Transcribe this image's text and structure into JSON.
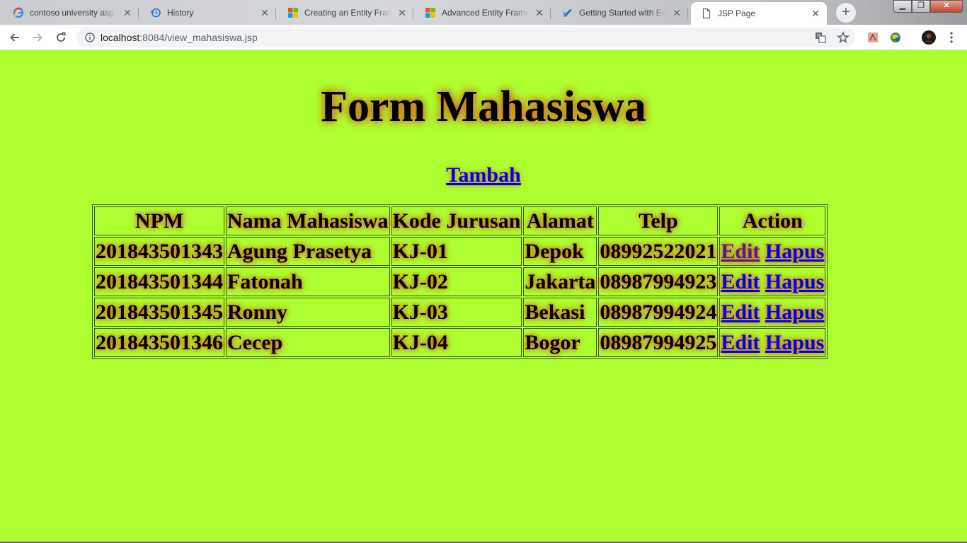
{
  "browser": {
    "tabs": [
      {
        "title": "contoso university asp.n",
        "icon": "google-icon",
        "active": false
      },
      {
        "title": "History",
        "icon": "history-icon",
        "active": false
      },
      {
        "title": "Creating an Entity Frame",
        "icon": "microsoft-icon",
        "active": false
      },
      {
        "title": "Advanced Entity Framew",
        "icon": "microsoft-icon",
        "active": false
      },
      {
        "title": "Getting Started with Enti",
        "icon": "visual-studio-icon",
        "active": false
      },
      {
        "title": "JSP Page",
        "icon": "page-icon",
        "active": true
      }
    ],
    "url_host": "localhost",
    "url_path": ":8084/view_mahasiswa.jsp"
  },
  "page": {
    "title": "Form Mahasiswa",
    "add_link": "Tambah",
    "columns": [
      "NPM",
      "Nama Mahasiswa",
      "Kode Jurusan",
      "Alamat",
      "Telp",
      "Action"
    ],
    "rows": [
      {
        "npm": "201843501343",
        "nama": "Agung Prasetya",
        "kode": "KJ-01",
        "alamat": "Depok",
        "telp": "08992522021",
        "edit": "Edit",
        "hapus": "Hapus"
      },
      {
        "npm": "201843501344",
        "nama": "Fatonah",
        "kode": "KJ-02",
        "alamat": "Jakarta",
        "telp": "08987994923",
        "edit": "Edit",
        "hapus": "Hapus"
      },
      {
        "npm": "201843501345",
        "nama": "Ronny",
        "kode": "KJ-03",
        "alamat": "Bekasi",
        "telp": "08987994924",
        "edit": "Edit",
        "hapus": "Hapus"
      },
      {
        "npm": "201843501346",
        "nama": "Cecep",
        "kode": "KJ-04",
        "alamat": "Bogor",
        "telp": "08987994925",
        "edit": "Edit",
        "hapus": "Hapus"
      }
    ]
  },
  "colors": {
    "page_background": "#adff2f",
    "text_glow": "#d2691e",
    "link": "#0000ee",
    "visited_link": "#551a8b"
  }
}
